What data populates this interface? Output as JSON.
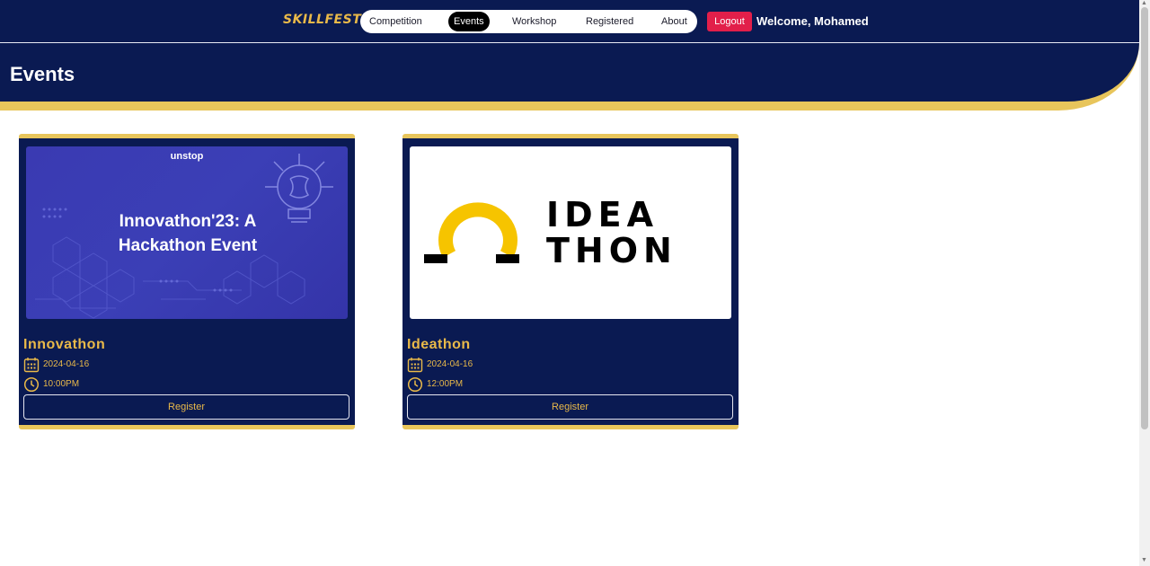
{
  "header": {
    "logo": "SKILLFEST",
    "nav": [
      "Competition",
      "Events",
      "Workshop",
      "Registered",
      "About"
    ],
    "active_nav": "Events",
    "logout_label": "Logout",
    "welcome": "Welcome, Mohamed"
  },
  "banner": {
    "title": "Events"
  },
  "events": [
    {
      "title": "Innovathon",
      "image_brand": "unstop",
      "image_text_line1": "Innovathon'23: A",
      "image_text_line2": "Hackathon Event",
      "date": "2024-04-16",
      "time": "10:00PM",
      "register_label": "Register"
    },
    {
      "title": "Ideathon",
      "image_logo_text_line1": "IDEA",
      "image_logo_text_line2": "THON",
      "date": "2024-04-16",
      "time": "12:00PM",
      "register_label": "Register"
    }
  ],
  "colors": {
    "navy": "#0a1a52",
    "gold": "#e8c55b",
    "logout": "#e21f4a"
  }
}
